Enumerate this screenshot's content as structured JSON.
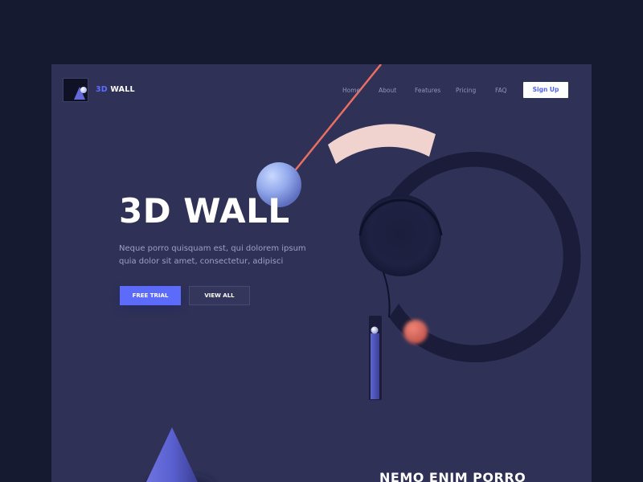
{
  "brand": {
    "logo_accent": "3D",
    "logo_rest": "WALL"
  },
  "nav": {
    "items": [
      "Home",
      "About",
      "Features",
      "Pricing",
      "FAQ"
    ],
    "signup_label": "Sign Up"
  },
  "hero": {
    "title": "3D WALL",
    "description_line1": "Neque porro quisquam est, qui dolorem ipsum",
    "description_line2": "quia dolor sit amet, consectetur, adipisci",
    "primary_button": "FREE TRIAL",
    "secondary_button": "VIEW ALL"
  },
  "next_section": {
    "heading": "NEMO ENIM PORRO"
  },
  "colors": {
    "page_background": "#161a31",
    "panel_background": "#2f3157",
    "accent_blue": "#5d6bfa",
    "accent_coral": "#e86f62",
    "pale_pink": "#f0d3cf"
  }
}
